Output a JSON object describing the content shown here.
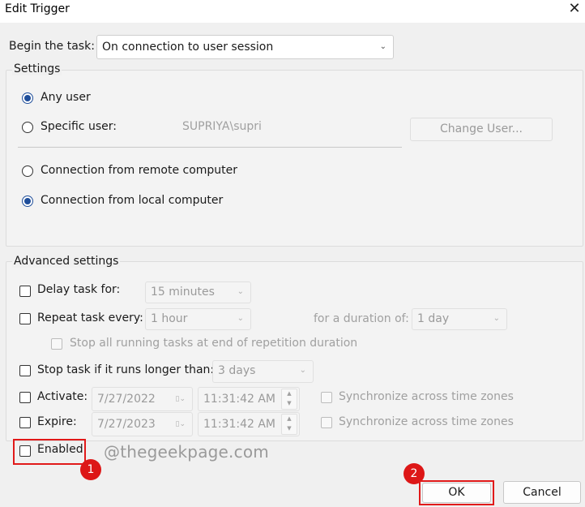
{
  "window": {
    "title": "Edit Trigger"
  },
  "begin": {
    "label": "Begin the task:",
    "value": "On connection to user session"
  },
  "settings": {
    "title": "Settings",
    "any_user": "Any user",
    "specific_user": "Specific user:",
    "user_value": "SUPRIYA\\supri",
    "change_user": "Change User...",
    "remote": "Connection from remote computer",
    "local": "Connection from local computer"
  },
  "advanced": {
    "title": "Advanced settings",
    "delay": {
      "label": "Delay task for:",
      "value": "15 minutes"
    },
    "repeat": {
      "label": "Repeat task every:",
      "value": "1 hour",
      "duration_label": "for a duration of:",
      "duration_value": "1 day"
    },
    "stop_running": "Stop all running tasks at end of repetition duration",
    "stop_longer": {
      "label": "Stop task if it runs longer than:",
      "value": "3 days"
    },
    "activate": {
      "label": "Activate:",
      "date": "7/27/2022",
      "time": "11:31:42 AM",
      "sync": "Synchronize across time zones"
    },
    "expire": {
      "label": "Expire:",
      "date": "7/27/2023",
      "time": "11:31:42 AM",
      "sync": "Synchronize across time zones"
    },
    "enabled": "Enabled"
  },
  "watermark": "@thegeekpage.com",
  "badges": {
    "one": "1",
    "two": "2"
  },
  "buttons": {
    "ok": "OK",
    "cancel": "Cancel"
  },
  "colors": {
    "highlight": "#e11a1a",
    "badge": "#dd1717",
    "radio_checked": "#1f4e9a"
  }
}
